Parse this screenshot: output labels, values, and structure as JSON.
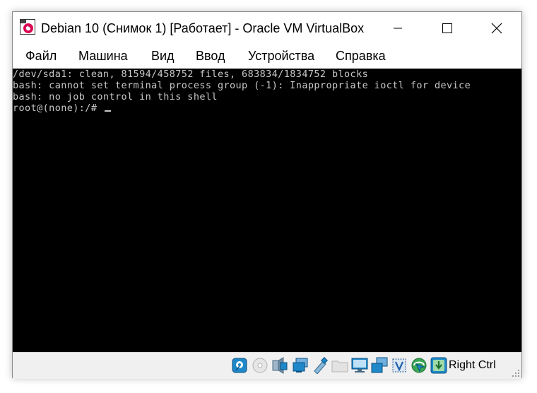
{
  "window": {
    "title": "Debian 10 (Снимок 1) [Работает] - Oracle VM VirtualBox",
    "icon": "virtualbox-debian-icon",
    "controls": [
      "minimize-icon",
      "maximize-icon",
      "close-icon"
    ]
  },
  "menu": {
    "items": [
      "Файл",
      "Машина",
      "Вид",
      "Ввод",
      "Устройства",
      "Справка"
    ]
  },
  "terminal": {
    "lines": [
      "/dev/sda1: clean, 81594/458752 files, 683834/1834752 blocks",
      "bash: cannot set terminal process group (-1): Inappropriate ioctl for device",
      "bash: no job control in this shell",
      "root@(none):/# "
    ],
    "colors": {
      "background": "#000000",
      "text": "#c8c8c8"
    }
  },
  "statusbar": {
    "icons": [
      "hard-disk-icon",
      "optical-disk-icon",
      "audio-icon",
      "network-icon",
      "usb-icon",
      "shared-folder-icon",
      "display-icon",
      "video-capture-icon",
      "vtx-icon",
      "mouse-integration-icon",
      "keyboard-capture-icon"
    ],
    "host_key": "Right Ctrl"
  }
}
